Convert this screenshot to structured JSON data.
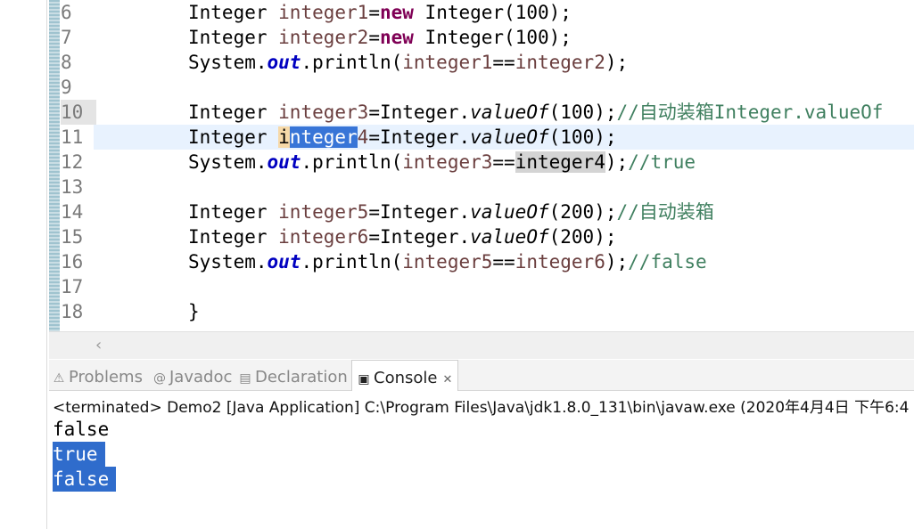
{
  "editor": {
    "lines": [
      {
        "num": "6",
        "parts": [
          [
            "t",
            "Integer "
          ],
          [
            "var",
            "integer1"
          ],
          [
            "t",
            "="
          ],
          [
            "kw",
            "new"
          ],
          [
            "t",
            " Integer(100);"
          ]
        ]
      },
      {
        "num": "7",
        "parts": [
          [
            "t",
            "Integer "
          ],
          [
            "var",
            "integer2"
          ],
          [
            "t",
            "="
          ],
          [
            "kw",
            "new"
          ],
          [
            "t",
            " Integer(100);"
          ]
        ]
      },
      {
        "num": "8",
        "parts": [
          [
            "t",
            "System."
          ],
          [
            "fld",
            "out"
          ],
          [
            "t",
            ".println("
          ],
          [
            "var",
            "integer1"
          ],
          [
            "t",
            "=="
          ],
          [
            "var",
            "integer2"
          ],
          [
            "t",
            ");"
          ]
        ]
      },
      {
        "num": "9",
        "parts": []
      },
      {
        "num": "10",
        "parts": [
          [
            "t",
            "Integer "
          ],
          [
            "var",
            "integer3"
          ],
          [
            "t",
            "=Integer."
          ],
          [
            "mth",
            "valueOf"
          ],
          [
            "t",
            "(100);"
          ],
          [
            "cmt",
            "//自动装箱Integer.valueOf"
          ]
        ]
      },
      {
        "num": "11",
        "parts": [
          [
            "t",
            "Integer "
          ],
          [
            "occw",
            "i"
          ],
          [
            "sel",
            "nteger"
          ],
          [
            "var",
            "4"
          ],
          [
            "t",
            "=Integer."
          ],
          [
            "mth",
            "valueOf"
          ],
          [
            "t",
            "(100);"
          ]
        ]
      },
      {
        "num": "12",
        "parts": [
          [
            "t",
            "System."
          ],
          [
            "fld",
            "out"
          ],
          [
            "t",
            ".println("
          ],
          [
            "var",
            "integer3"
          ],
          [
            "t",
            "=="
          ],
          [
            "occ",
            "integer4"
          ],
          [
            "t",
            ");"
          ],
          [
            "cmt",
            "//true"
          ]
        ]
      },
      {
        "num": "13",
        "parts": []
      },
      {
        "num": "14",
        "parts": [
          [
            "t",
            "Integer "
          ],
          [
            "var",
            "integer5"
          ],
          [
            "t",
            "=Integer."
          ],
          [
            "mth",
            "valueOf"
          ],
          [
            "t",
            "(200);"
          ],
          [
            "cmt",
            "//自动装箱"
          ]
        ]
      },
      {
        "num": "15",
        "parts": [
          [
            "t",
            "Integer "
          ],
          [
            "var",
            "integer6"
          ],
          [
            "t",
            "=Integer."
          ],
          [
            "mth",
            "valueOf"
          ],
          [
            "t",
            "(200);"
          ]
        ]
      },
      {
        "num": "16",
        "parts": [
          [
            "t",
            "System."
          ],
          [
            "fld",
            "out"
          ],
          [
            "t",
            ".println("
          ],
          [
            "var",
            "integer5"
          ],
          [
            "t",
            "=="
          ],
          [
            "var",
            "integer6"
          ],
          [
            "t",
            ");"
          ],
          [
            "cmt",
            "//false"
          ]
        ]
      },
      {
        "num": "17",
        "parts": []
      },
      {
        "num": "18",
        "parts": [
          [
            "t",
            "}"
          ]
        ]
      }
    ],
    "partial_next": "}"
  },
  "tabs": [
    {
      "label": "Problems",
      "icon": "problems-icon",
      "glyph": "⚠"
    },
    {
      "label": "Javadoc",
      "icon": "javadoc-icon",
      "glyph": "@"
    },
    {
      "label": "Declaration",
      "icon": "declaration-icon",
      "glyph": "▤"
    },
    {
      "label": "Console",
      "icon": "console-icon",
      "glyph": "▣",
      "close": "✕"
    }
  ],
  "console": {
    "header": "<terminated> Demo2 [Java Application] C:\\Program Files\\Java\\jdk1.8.0_131\\bin\\javaw.exe (2020年4月4日 下午6:4",
    "output": [
      "false",
      "true",
      "false"
    ]
  },
  "colors": {
    "keyword": "#7f0055",
    "field": "#0000c0",
    "comment": "#3f7f5f",
    "variable": "#6a3e3e",
    "selection": "#3875d7"
  }
}
